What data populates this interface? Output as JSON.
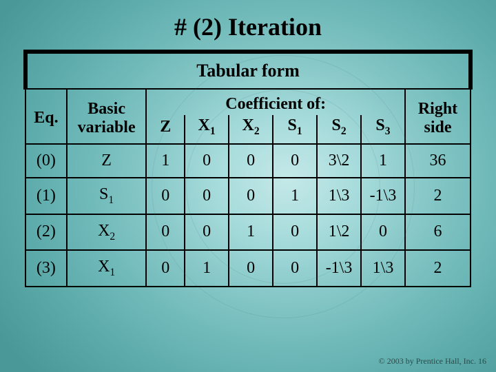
{
  "title": "# (2) Iteration",
  "table": {
    "caption": "Tabular form",
    "headers": {
      "eq": "Eq.",
      "basic": "Basic variable",
      "coef_of": "Coefficient of:",
      "right": "Right side",
      "cols": {
        "z": "Z",
        "x1": "X1",
        "x2": "X2",
        "s1": "S1",
        "s2": "S2",
        "s3": "S3"
      }
    },
    "rows": [
      {
        "eq": "(0)",
        "basic": "Z",
        "z": "1",
        "x1": "0",
        "x2": "0",
        "s1": "0",
        "s2": "3\\2",
        "s3": "1",
        "right": "36"
      },
      {
        "eq": "(1)",
        "basic": "S1",
        "z": "0",
        "x1": "0",
        "x2": "0",
        "s1": "1",
        "s2": "1\\3",
        "s3": "-1\\3",
        "right": "2"
      },
      {
        "eq": "(2)",
        "basic": "X2",
        "z": "0",
        "x1": "0",
        "x2": "1",
        "s1": "0",
        "s2": "1\\2",
        "s3": "0",
        "right": "6"
      },
      {
        "eq": "(3)",
        "basic": "X1",
        "z": "0",
        "x1": "1",
        "x2": "0",
        "s1": "0",
        "s2": "-1\\3",
        "s3": "1\\3",
        "right": "2"
      }
    ]
  },
  "footer": "© 2003 by Prentice Hall, Inc. 16",
  "chart_data": {
    "type": "table",
    "title": "# (2) Iteration — Tabular form",
    "columns": [
      "Eq.",
      "Basic variable",
      "Z",
      "X1",
      "X2",
      "S1",
      "S2",
      "S3",
      "Right side"
    ],
    "rows": [
      [
        "(0)",
        "Z",
        1,
        0,
        0,
        0,
        "3/2",
        1,
        36
      ],
      [
        "(1)",
        "S1",
        0,
        0,
        0,
        1,
        "1/3",
        "-1/3",
        2
      ],
      [
        "(2)",
        "X2",
        0,
        0,
        1,
        0,
        "1/2",
        0,
        6
      ],
      [
        "(3)",
        "X1",
        0,
        1,
        0,
        0,
        "-1/3",
        "1/3",
        2
      ]
    ]
  }
}
